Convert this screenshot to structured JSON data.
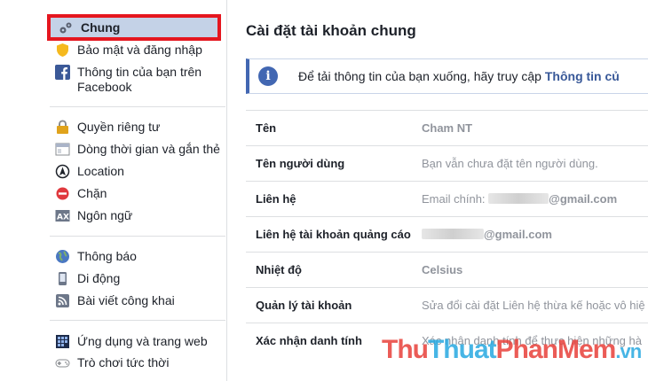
{
  "sidebar": {
    "active_item": {
      "label": "Chung",
      "icon": "gear-icon"
    },
    "group1": [
      {
        "label": "Bảo mật và đăng nhập",
        "icon": "shield-icon"
      },
      {
        "label": "Thông tin của bạn trên Facebook",
        "icon": "facebook-icon"
      }
    ],
    "group2": [
      {
        "label": "Quyền riêng tư",
        "icon": "lock-icon"
      },
      {
        "label": "Dòng thời gian và gắn thẻ",
        "icon": "timeline-icon"
      },
      {
        "label": "Location",
        "icon": "location-icon"
      },
      {
        "label": "Chặn",
        "icon": "block-icon"
      },
      {
        "label": "Ngôn ngữ",
        "icon": "language-icon"
      }
    ],
    "group3": [
      {
        "label": "Thông báo",
        "icon": "globe-icon"
      },
      {
        "label": "Di động",
        "icon": "mobile-icon"
      },
      {
        "label": "Bài viết công khai",
        "icon": "rss-icon"
      }
    ],
    "group4": [
      {
        "label": "Ứng dụng và trang web",
        "icon": "apps-icon"
      },
      {
        "label": "Trò chơi tức thời",
        "icon": "gamepad-icon"
      }
    ]
  },
  "main": {
    "title": "Cài đặt tài khoản chung",
    "banner": {
      "text": "Để tải thông tin của bạn xuống, hãy truy cập ",
      "link": "Thông tin củ"
    },
    "rows": [
      {
        "label": "Tên",
        "value": "Cham NT",
        "strong": true
      },
      {
        "label": "Tên người dùng",
        "value": "Bạn vẫn chưa đặt tên người dùng.",
        "strong": false
      },
      {
        "label": "Liên hệ",
        "value_prefix": "Email chính: ",
        "value_suffix": "@gmail.com"
      },
      {
        "label": "Liên hệ tài khoản quảng cáo",
        "value_suffix": "@gmail.com"
      },
      {
        "label": "Nhiệt độ",
        "value": "Celsius",
        "strong": true
      },
      {
        "label": "Quản lý tài khoản",
        "value": "Sửa đổi cài đặt Liên hệ thừa kế hoặc vô hiệ",
        "strong": false
      },
      {
        "label": "Xác nhận danh tính",
        "value": "Xác nhận danh tính để thực hiện những hà",
        "strong": false
      }
    ]
  },
  "watermark": {
    "part1": "Thu",
    "part2": "Thuat",
    "part3": "PhanMem",
    "part4": ".vn"
  },
  "colors": {
    "accent": "#4267b2",
    "active_bg": "#c4d2e7",
    "highlight_border": "#e5161f"
  }
}
